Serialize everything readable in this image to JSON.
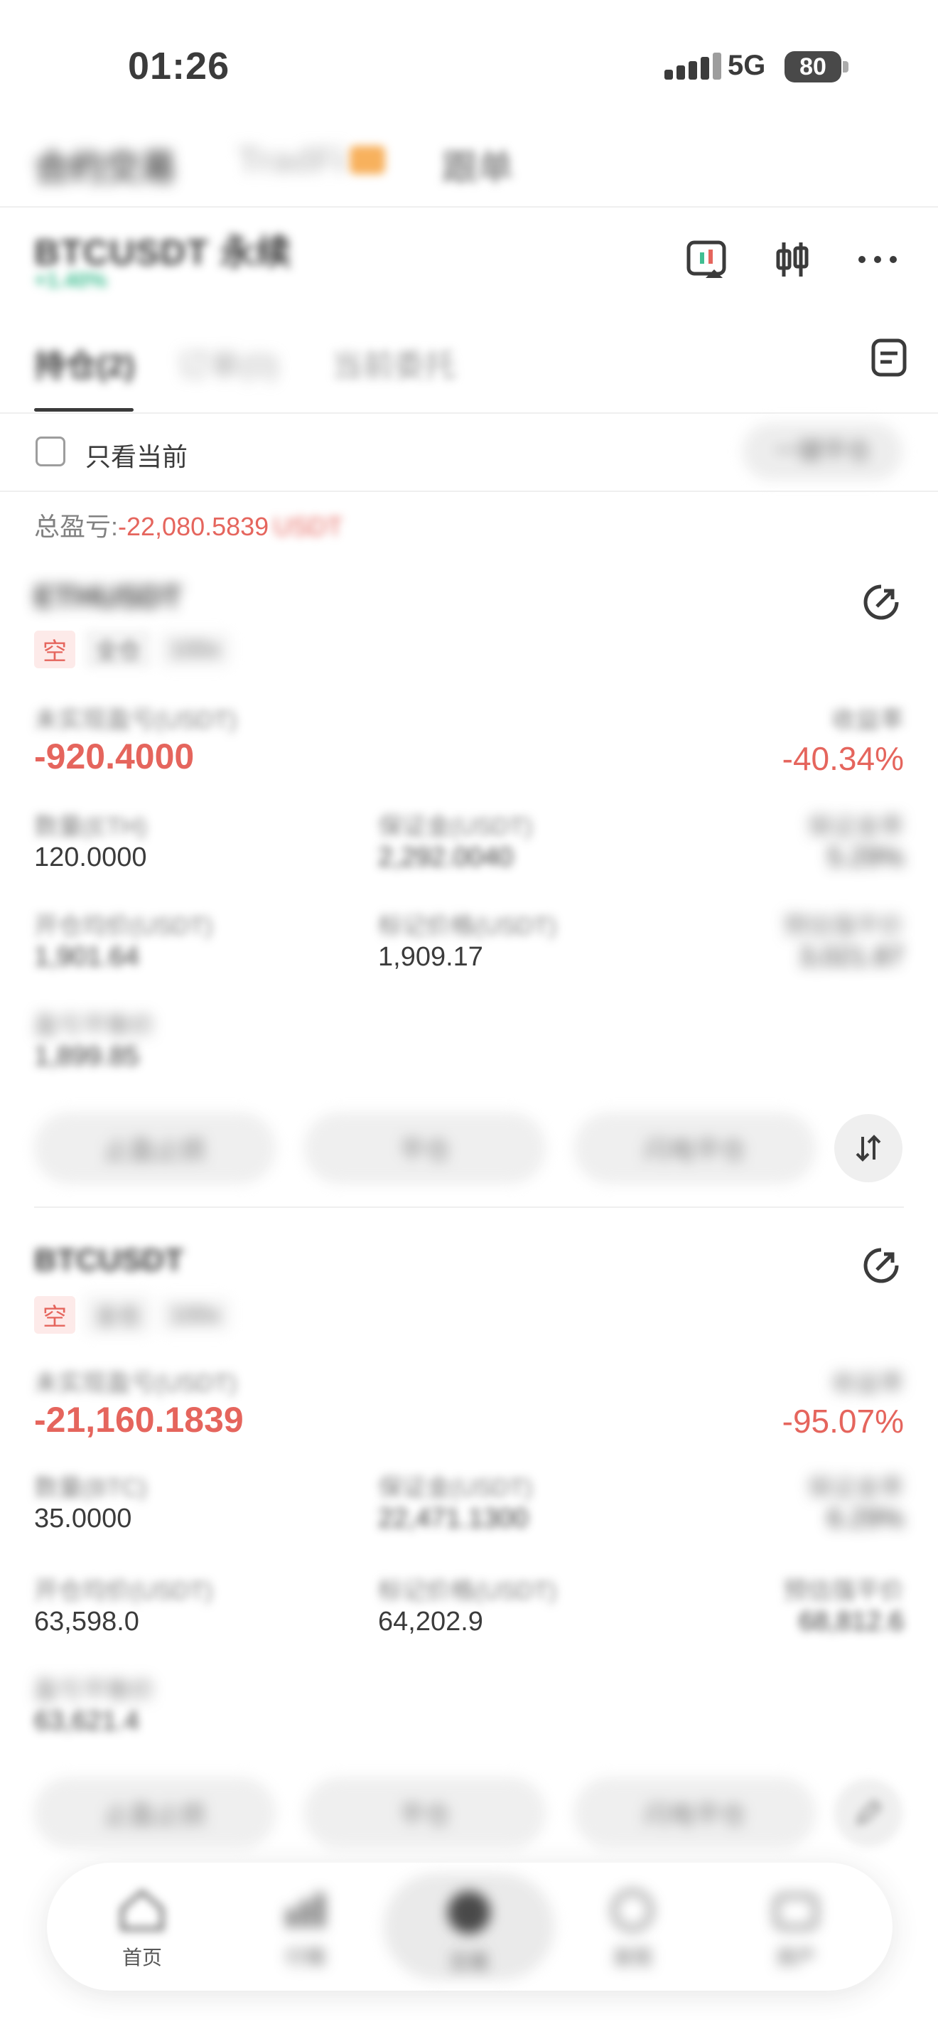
{
  "status_bar": {
    "time": "01:26",
    "network": "5G",
    "battery": "80"
  },
  "top_tabs": [
    {
      "label": "合约交易"
    },
    {
      "label": "TradFi"
    },
    {
      "label": "跟单"
    }
  ],
  "symbol": {
    "name": "BTCUSDT 永续",
    "change": "+1.40%"
  },
  "sub_tabs": [
    {
      "label": "持仓(2)"
    },
    {
      "label": "订单(0)"
    },
    {
      "label": "当前委托"
    }
  ],
  "filter": {
    "label": "只看当前",
    "close_all": "一键平仓"
  },
  "total": {
    "label": "总盈亏:",
    "value": "-22,080.5839",
    "unit": "USDT"
  },
  "positions": [
    {
      "symbol": "ETHUSDT",
      "side": "空",
      "margin_mode": "全仓",
      "leverage": "100x",
      "pnl_label": "未实现盈亏(USDT)",
      "pnl": "-920.4000",
      "roi_label": "收益率",
      "roi": "-40.34%",
      "qty_label": "数量(ETH)",
      "qty": "120.0000",
      "margin_label": "保证金(USDT)",
      "margin": "2,292.0040",
      "margin_ratio_label": "保证金率",
      "margin_ratio": "5.29%",
      "entry_label": "开仓均价(USDT)",
      "entry": "1,901.64",
      "mark_label": "标记价格(USDT)",
      "mark": "1,909.17",
      "liq_label": "预估强平价",
      "liq": "3,021.87",
      "breakeven_label": "盈亏平衡价",
      "breakeven": "1,899.85",
      "buttons": [
        "止盈止损",
        "平仓",
        "闪电平仓"
      ]
    },
    {
      "symbol": "BTCUSDT",
      "side": "空",
      "margin_mode": "全仓",
      "leverage": "100x",
      "pnl_label": "未实现盈亏(USDT)",
      "pnl": "-21,160.1839",
      "roi_label": "收益率",
      "roi": "-95.07%",
      "qty_label": "数量(BTC)",
      "qty": "35.0000",
      "margin_label": "保证金(USDT)",
      "margin": "22,471.1300",
      "margin_ratio_label": "保证金率",
      "margin_ratio": "6.29%",
      "entry_label": "开仓均价(USDT)",
      "entry": "63,598.0",
      "mark_label": "标记价格(USDT)",
      "mark": "64,202.9",
      "liq_label": "预估强平价",
      "liq": "68,812.6",
      "breakeven_label": "盈亏平衡价",
      "breakeven": "63,621.4",
      "buttons": [
        "止盈止损",
        "平仓",
        "闪电平仓"
      ]
    }
  ],
  "bottom_nav": [
    {
      "label": "首页",
      "icon": "home-icon"
    },
    {
      "label": "行情",
      "icon": "chart-icon"
    },
    {
      "label": "交易",
      "icon": "trade-icon"
    },
    {
      "label": "发现",
      "icon": "discover-icon"
    },
    {
      "label": "资产",
      "icon": "wallet-icon"
    }
  ],
  "colors": {
    "loss": "#e0443a",
    "gain": "#18b07a"
  }
}
